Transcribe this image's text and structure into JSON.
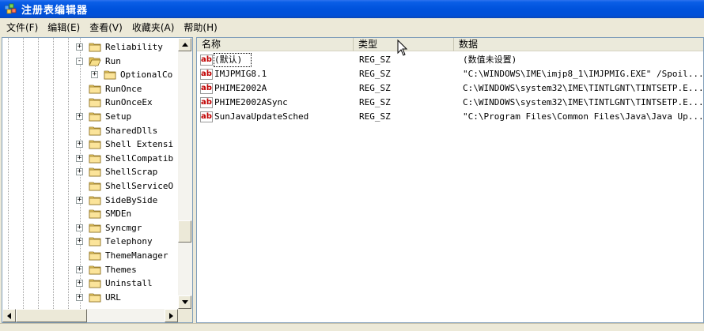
{
  "window": {
    "title": "注册表编辑器"
  },
  "menu": [
    {
      "label": "文件(F)"
    },
    {
      "label": "编辑(E)"
    },
    {
      "label": "查看(V)"
    },
    {
      "label": "收藏夹(A)"
    },
    {
      "label": "帮助(H)"
    }
  ],
  "tree": {
    "items": [
      {
        "label": "Reliability",
        "expander": "+",
        "open": false
      },
      {
        "label": "Run",
        "expander": "-",
        "open": true
      },
      {
        "label": "OptionalCo",
        "expander": "+",
        "open": false
      },
      {
        "label": "RunOnce",
        "expander": "",
        "open": false
      },
      {
        "label": "RunOnceEx",
        "expander": "",
        "open": false
      },
      {
        "label": "Setup",
        "expander": "+",
        "open": false
      },
      {
        "label": "SharedDlls",
        "expander": "",
        "open": false
      },
      {
        "label": "Shell Extensi",
        "expander": "+",
        "open": false
      },
      {
        "label": "ShellCompatib",
        "expander": "+",
        "open": false
      },
      {
        "label": "ShellScrap",
        "expander": "+",
        "open": false
      },
      {
        "label": "ShellServiceO",
        "expander": "",
        "open": false
      },
      {
        "label": "SideBySide",
        "expander": "+",
        "open": false
      },
      {
        "label": "SMDEn",
        "expander": "",
        "open": false
      },
      {
        "label": "Syncmgr",
        "expander": "+",
        "open": false
      },
      {
        "label": "Telephony",
        "expander": "+",
        "open": false
      },
      {
        "label": "ThemeManager",
        "expander": "",
        "open": false
      },
      {
        "label": "Themes",
        "expander": "+",
        "open": false
      },
      {
        "label": "Uninstall",
        "expander": "+",
        "open": false
      },
      {
        "label": "URL",
        "expander": "+",
        "open": false
      }
    ],
    "scroll_position": 0.76
  },
  "values": {
    "columns": [
      "名称",
      "类型",
      "数据"
    ],
    "rows": [
      {
        "name": "(默认)",
        "type": "REG_SZ",
        "data": "(数值未设置)"
      },
      {
        "name": "IMJPMIG8.1",
        "type": "REG_SZ",
        "data": "\"C:\\WINDOWS\\IME\\imjp8_1\\IMJPMIG.EXE\" /Spoil..."
      },
      {
        "name": "PHIME2002A",
        "type": "REG_SZ",
        "data": "C:\\WINDOWS\\system32\\IME\\TINTLGNT\\TINTSETP.E..."
      },
      {
        "name": "PHIME2002ASync",
        "type": "REG_SZ",
        "data": "C:\\WINDOWS\\system32\\IME\\TINTLGNT\\TINTSETP.E..."
      },
      {
        "name": "SunJavaUpdateSched",
        "type": "REG_SZ",
        "data": "\"C:\\Program Files\\Common Files\\Java\\Java Up..."
      }
    ],
    "value_icon": "ab"
  },
  "colors": {
    "titlebar": "#0052dc",
    "folder": "#f5d76e",
    "string_icon": "#c00000"
  }
}
